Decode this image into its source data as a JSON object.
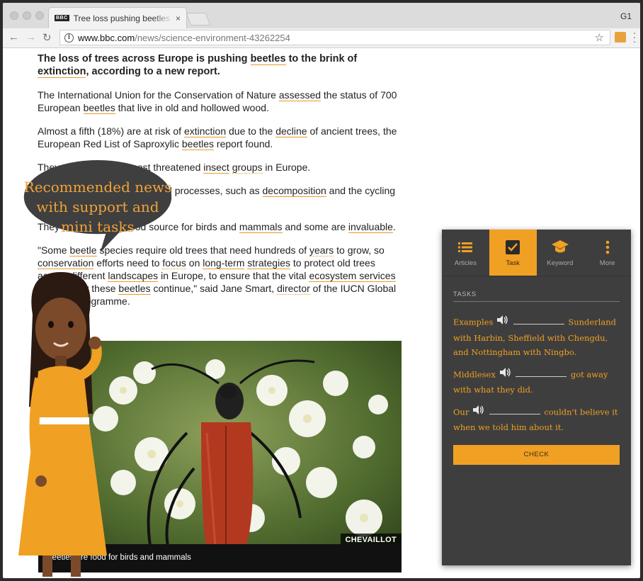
{
  "browser": {
    "tab_title": "Tree loss pushing beetles to the",
    "tab_favicon": "BBC",
    "tab_close": "×",
    "profile": "G1",
    "url_host": "www.bbc.com",
    "url_path": "/news/science-environment-43262254",
    "icons": [
      "back-icon",
      "forward-icon",
      "reload-icon",
      "info-icon",
      "star-icon",
      "extension-icon",
      "menu-icon"
    ]
  },
  "article": {
    "p1": {
      "a": "The loss of trees across Europe is pushing ",
      "k1": "beetles",
      "b": " to the brink of ",
      "k2": "extinction",
      "c": ", according to a new report."
    },
    "p2": {
      "a": "The International Union for the Conservation of Nature ",
      "k1": "assessed",
      "b": " the status of 700 European ",
      "k2": "beetles",
      "c": " that live in old and hollowed wood."
    },
    "p3": {
      "a": "Almost a fifth (18%) are at risk of ",
      "k1": "extinction",
      "b": " due to the ",
      "k2": "decline",
      "c": " of ancient trees, the European Red List of Saproxylic ",
      "k3": "beetles",
      "d": " report found."
    },
    "p4": {
      "a": "They are among the most threatened ",
      "k1": "insect",
      "b": " ",
      "k2": "groups",
      "c": " in Europe."
    },
    "p5": {
      "a": "They play a vital role in natural processes, such as ",
      "k1": "decomposition",
      "b": " and the cycling of nutrients."
    },
    "p6": {
      "a": "They also provide a food source for birds and ",
      "k1": "mammals",
      "b": " and some are ",
      "k2": "invaluable",
      "c": "."
    },
    "p7": {
      "a": "\"Some ",
      "k1": "beetle",
      "b": " species require old trees that need hundreds of ",
      "k2": "years",
      "c": " to grow, so ",
      "k3": "conservation",
      "d": " efforts need to ",
      "k4": "focus",
      "e": " on ",
      "k5": "long-term",
      "f": " ",
      "k6": "strategies",
      "g": " to protect old trees across different ",
      "k7": "landscapes",
      "h": " in Europe, to ensure that the vital ",
      "k8": "ecosystem services",
      "i": " provided by these ",
      "k9": "beetles",
      "j": " continue,\" said Jane Smart, ",
      "k10": "director",
      "k": " of the IUCN Global Species Programme."
    }
  },
  "figure": {
    "credit": "CHEVAILLOT",
    "caption": "Beetles are food for birds and mammals"
  },
  "bubble": {
    "line1": "Recommended news",
    "line2": "with support and",
    "line3": "mini tasks"
  },
  "panel": {
    "tabs": [
      {
        "label": "Articles",
        "icon": "list-icon"
      },
      {
        "label": "Task",
        "icon": "checkbox-icon"
      },
      {
        "label": "Keyword",
        "icon": "graduation-cap-icon"
      },
      {
        "label": "More",
        "icon": "more-vertical-icon"
      }
    ],
    "active_tab": "Task",
    "tasks_header": "TASKS",
    "task1": {
      "a": "Examples",
      "b": "Sunderland with Harbin, Sheffield with Chengdu, and Nottingham with Ningbo."
    },
    "task2": {
      "a": "Middlesex",
      "b": "got away with what they did."
    },
    "task3": {
      "a": "Our",
      "b": "couldn't believe it when we told him about it."
    },
    "check_label": "CHECK",
    "accent": "#f0a023"
  }
}
